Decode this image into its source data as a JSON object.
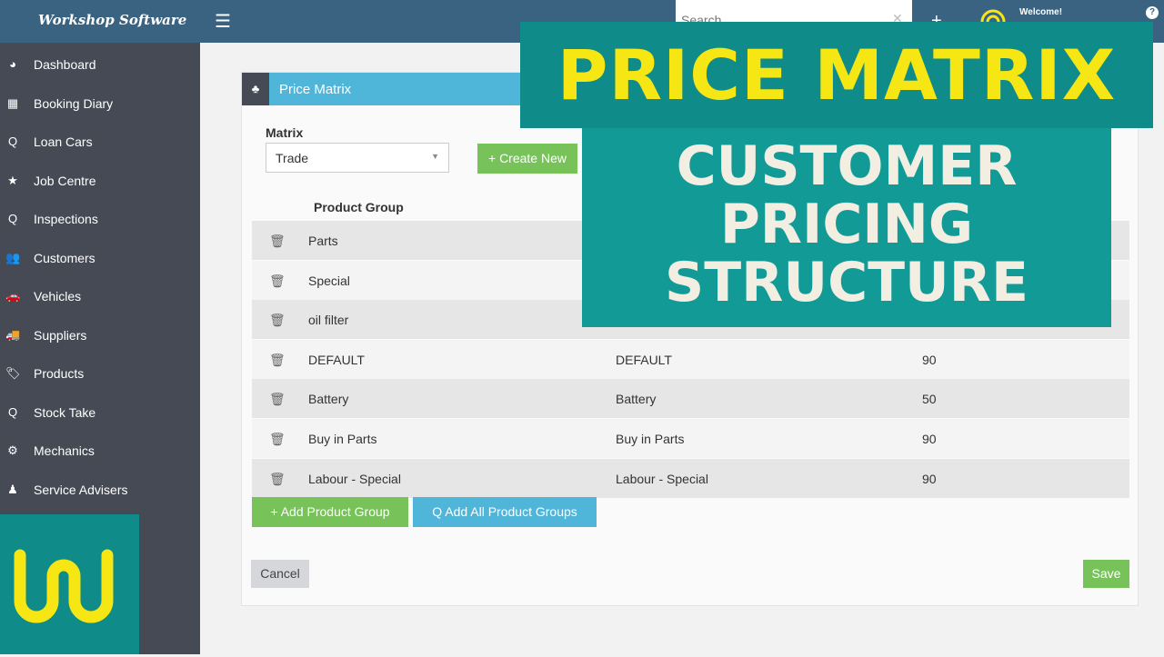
{
  "topbar": {
    "brand": "Workshop Software",
    "search_placeholder": "Search",
    "welcome": "Welcome!",
    "help": "?"
  },
  "sidebar": {
    "items": [
      {
        "label": "Dashboard",
        "icon": "dashboard-icon",
        "glyph": "◕"
      },
      {
        "label": "Booking Diary",
        "icon": "calendar-icon",
        "glyph": "▦"
      },
      {
        "label": "Loan Cars",
        "icon": "search-icon",
        "glyph": "Q"
      },
      {
        "label": "Job Centre",
        "icon": "star-icon",
        "glyph": "★"
      },
      {
        "label": "Inspections",
        "icon": "search-icon",
        "glyph": "Q"
      },
      {
        "label": "Customers",
        "icon": "users-icon",
        "glyph": "👥"
      },
      {
        "label": "Vehicles",
        "icon": "car-icon",
        "glyph": "🚗"
      },
      {
        "label": "Suppliers",
        "icon": "truck-icon",
        "glyph": "🚚"
      },
      {
        "label": "Products",
        "icon": "tags-icon",
        "glyph": "🏷"
      },
      {
        "label": "Stock Take",
        "icon": "search-icon",
        "glyph": "Q"
      },
      {
        "label": "Mechanics",
        "icon": "cogs-icon",
        "glyph": "⚙"
      },
      {
        "label": "Service Advisers",
        "icon": "user-icon",
        "glyph": "♟"
      }
    ]
  },
  "panel": {
    "title": "Price Matrix",
    "matrix_label": "Matrix",
    "matrix_value": "Trade",
    "create_new": "+ Create New",
    "column_header": "Product Group",
    "rows": [
      [
        "Parts",
        "",
        ""
      ],
      [
        "Special",
        "",
        ""
      ],
      [
        "oil filter",
        "",
        ""
      ],
      [
        "DEFAULT",
        "DEFAULT",
        "90"
      ],
      [
        "Battery",
        "Battery",
        "50"
      ],
      [
        "Buy in Parts",
        "Buy in Parts",
        "90"
      ],
      [
        "Labour - Special",
        "Labour - Special",
        "90"
      ]
    ],
    "add_group": "+ Add Product Group",
    "add_all": "Q Add All Product Groups",
    "cancel": "Cancel",
    "save": "Save"
  },
  "overlay": {
    "title": "PRICE MATRIX",
    "subtitle": [
      "CUSTOMER",
      "PRICING",
      "STRUCTURE"
    ]
  },
  "colors": {
    "topbar": "#3a6382",
    "sidebar": "#454a54",
    "accent_blue": "#4fb6d9",
    "accent_green": "#77c35a",
    "teal": "#0f8c89",
    "yellow": "#f5e614"
  }
}
